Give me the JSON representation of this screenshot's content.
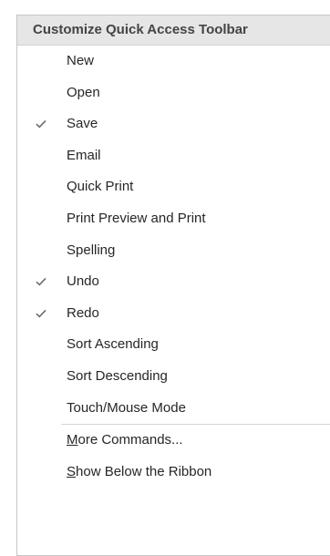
{
  "menu": {
    "title": "Customize Quick Access Toolbar",
    "items": [
      {
        "label": "New",
        "checked": false
      },
      {
        "label": "Open",
        "checked": false
      },
      {
        "label": "Save",
        "checked": true
      },
      {
        "label": "Email",
        "checked": false
      },
      {
        "label": "Quick Print",
        "checked": false
      },
      {
        "label": "Print Preview and Print",
        "checked": false
      },
      {
        "label": "Spelling",
        "checked": false
      },
      {
        "label": "Undo",
        "checked": true
      },
      {
        "label": "Redo",
        "checked": true
      },
      {
        "label": "Sort Ascending",
        "checked": false
      },
      {
        "label": "Sort Descending",
        "checked": false
      },
      {
        "label": "Touch/Mouse Mode",
        "checked": false
      }
    ],
    "more_commands": {
      "accel": "M",
      "rest": "ore Commands..."
    },
    "show_below": {
      "accel": "S",
      "rest": "how Below the Ribbon"
    }
  },
  "colors": {
    "header_bg": "#e6e6e6",
    "check": "#6a6a6a",
    "text": "#262626"
  }
}
